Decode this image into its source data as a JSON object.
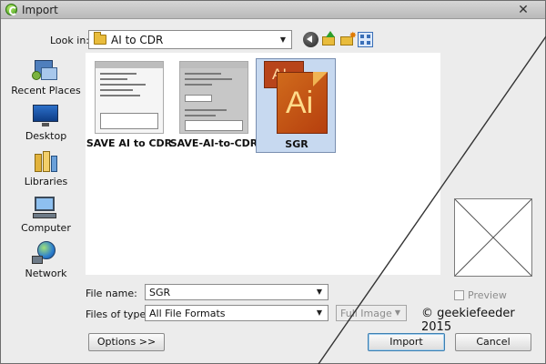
{
  "window": {
    "title": "Import"
  },
  "toolbar": {
    "look_in_label": "Look in:",
    "look_in_value": "AI to CDR",
    "icons": [
      "back-icon",
      "up-folder-icon",
      "new-folder-icon",
      "view-menu-icon"
    ]
  },
  "places": [
    {
      "label": "Recent Places",
      "icon": "recent-places-icon"
    },
    {
      "label": "Desktop",
      "icon": "desktop-icon"
    },
    {
      "label": "Libraries",
      "icon": "libraries-icon"
    },
    {
      "label": "Computer",
      "icon": "computer-icon"
    },
    {
      "label": "Network",
      "icon": "network-icon"
    }
  ],
  "files": [
    {
      "name": "SAVE AI to CDR",
      "type": "image-thumbnail",
      "selected": false
    },
    {
      "name": "SAVE-AI-to-CDR",
      "type": "image-thumbnail",
      "selected": false
    },
    {
      "name": "SGR",
      "type": "illustrator-file",
      "selected": true,
      "icon_text_back": "AI",
      "icon_text_front": "Ai"
    }
  ],
  "form": {
    "file_name_label": "File name:",
    "file_name_value": "SGR",
    "file_type_label": "Files of type:",
    "file_type_value": "All File Formats",
    "image_mode_value": "Full Image"
  },
  "preview": {
    "label": "Preview",
    "checked": false
  },
  "watermark": "© geekiefeeder 2015",
  "buttons": {
    "options": "Options >>",
    "import": "Import",
    "cancel": "Cancel"
  },
  "colors": {
    "selection": "#c7d9f0",
    "ai_orange": "#c4531a",
    "default_button_border": "#3c7fb1"
  }
}
